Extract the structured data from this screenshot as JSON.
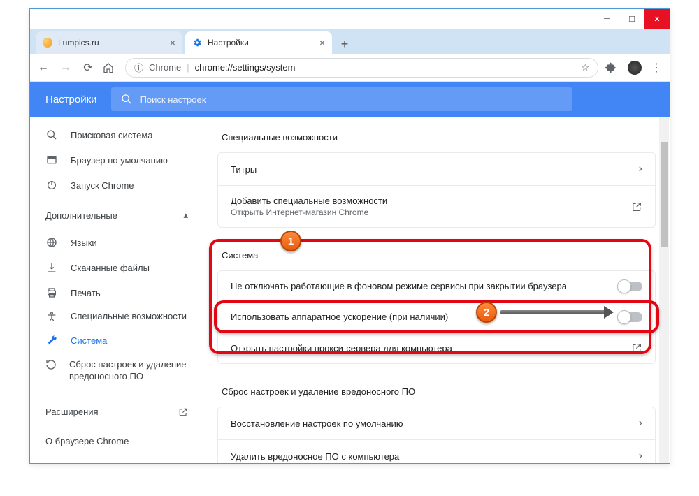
{
  "tabs": [
    {
      "title": "Lumpics.ru"
    },
    {
      "title": "Настройки"
    }
  ],
  "omnibox": {
    "label": "Chrome",
    "url": "chrome://settings/system"
  },
  "header": {
    "title": "Настройки",
    "search_placeholder": "Поиск настроек"
  },
  "sidebar": {
    "items": [
      {
        "label": "Поисковая система"
      },
      {
        "label": "Браузер по умолчанию"
      },
      {
        "label": "Запуск Chrome"
      }
    ],
    "advanced_label": "Дополнительные",
    "adv_items": [
      {
        "label": "Языки"
      },
      {
        "label": "Скачанные файлы"
      },
      {
        "label": "Печать"
      },
      {
        "label": "Специальные возможности"
      },
      {
        "label": "Система"
      },
      {
        "label": "Сброс настроек и удаление вредоносного ПО"
      }
    ],
    "extensions": "Расширения",
    "about": "О браузере Chrome"
  },
  "sections": {
    "accessibility": {
      "title": "Специальные возможности",
      "row1": "Титры",
      "row2_title": "Добавить специальные возможности",
      "row2_sub": "Открыть Интернет-магазин Chrome"
    },
    "system": {
      "title": "Система",
      "row1": "Не отключать работающие в фоновом режиме сервисы при закрытии браузера",
      "row2": "Использовать аппаратное ускорение (при наличии)",
      "row3": "Открыть настройки прокси-сервера для компьютера"
    },
    "reset": {
      "title": "Сброс настроек и удаление вредоносного ПО",
      "row1": "Восстановление настроек по умолчанию",
      "row2": "Удалить вредоносное ПО с компьютера"
    }
  },
  "badges": {
    "b1": "1",
    "b2": "2"
  }
}
